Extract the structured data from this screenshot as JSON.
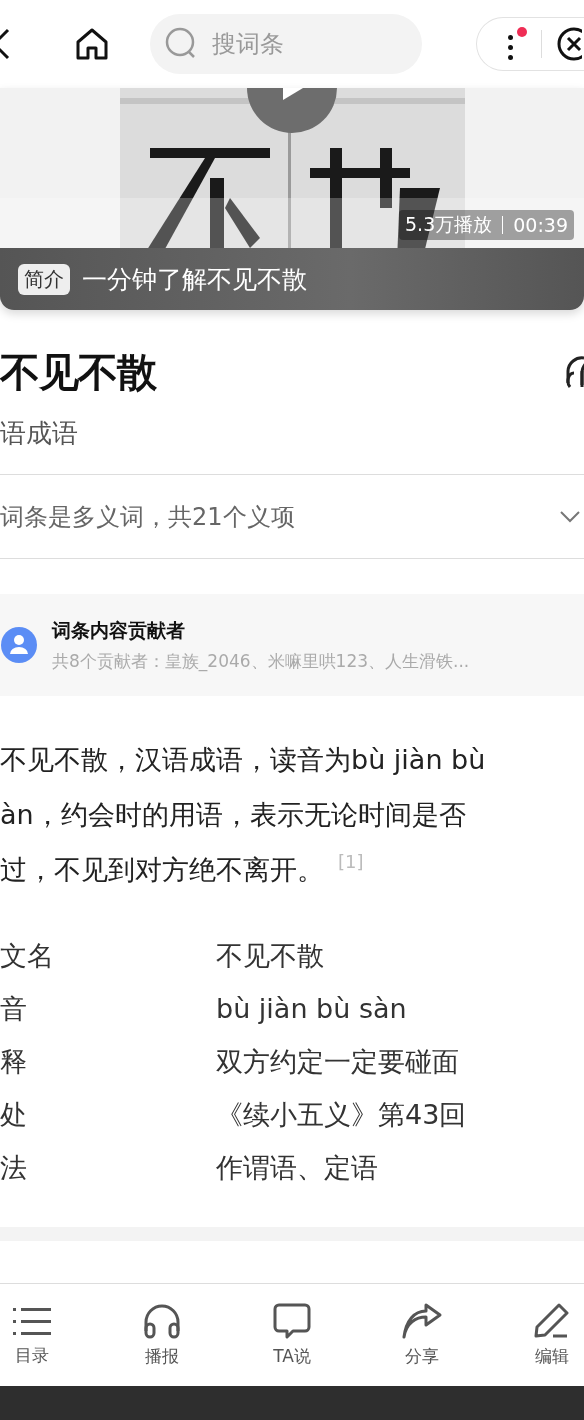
{
  "search": {
    "placeholder": "搜词条"
  },
  "more_menu": {
    "notification": true
  },
  "video": {
    "stats": "5.3万播放",
    "duration": "00:39",
    "badge": "简介",
    "caption": "一分钟了解不见不散"
  },
  "entry": {
    "title": "不见不散",
    "subtitle": "语成语"
  },
  "senses": {
    "text": "词条是多义词，共21个义项",
    "expanded": false
  },
  "contributors": {
    "title": "词条内容贡献者",
    "names": "共8个贡献者：皇族_2046、米嘛里哄123、人生滑铁..."
  },
  "summary": {
    "lines": [
      "不见不散，汉语成语，读音为bù jiàn bù",
      "àn，约会时的用语，表示无论时间是否",
      "过，不见到对方绝不离开。"
    ],
    "footnote": "[1]"
  },
  "info": [
    {
      "label": "文名",
      "value": "不见不散"
    },
    {
      "label": "音",
      "value": "bù jiàn bù sàn"
    },
    {
      "label": "释",
      "value": "双方约定一定要碰面"
    },
    {
      "label": "处",
      "value": "《续小五义》第43回"
    },
    {
      "label": "法",
      "value": "作谓语、定语"
    }
  ],
  "bottom_nav": [
    {
      "label": "目录"
    },
    {
      "label": "播报"
    },
    {
      "label": "TA说"
    },
    {
      "label": "分享"
    },
    {
      "label": "编辑"
    }
  ]
}
